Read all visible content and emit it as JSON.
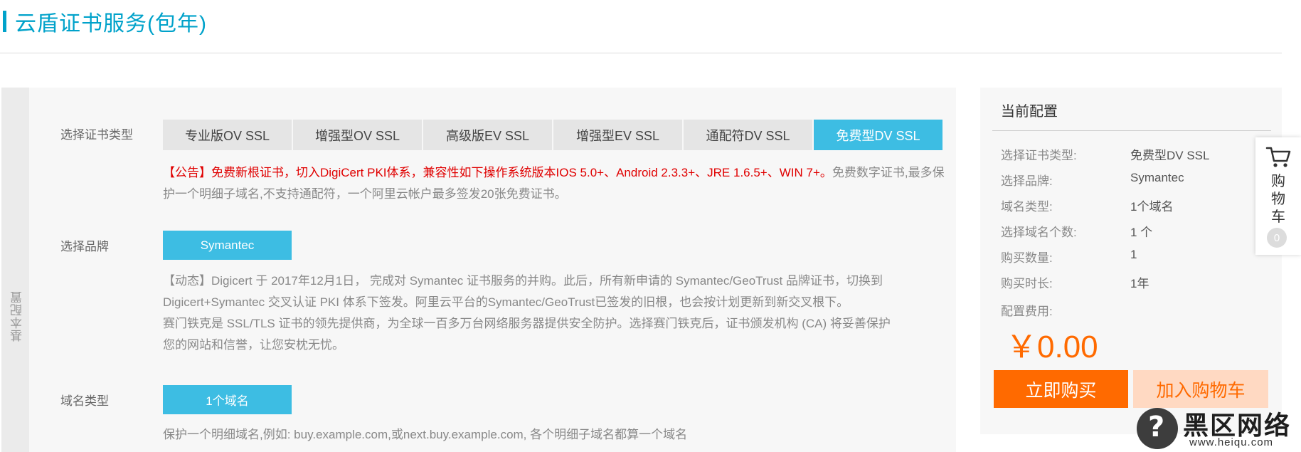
{
  "page": {
    "title": "云盾证书服务(包年)"
  },
  "main": {
    "side_tab_label": "基本配置",
    "cert_type": {
      "label": "选择证书类型",
      "tabs": [
        {
          "label": "专业版OV SSL",
          "active": false
        },
        {
          "label": "增强型OV SSL",
          "active": false
        },
        {
          "label": "高级版EV SSL",
          "active": false
        },
        {
          "label": "增强型EV SSL",
          "active": false
        },
        {
          "label": "通配符DV SSL",
          "active": false
        },
        {
          "label": "免费型DV SSL",
          "active": true
        }
      ],
      "notice_red": "【公告】免费新根证书，切入DigiCert PKI体系，兼容性如下操作系统版本IOS 5.0+、Android 2.3.3+、JRE 1.6.5+、WIN 7+。",
      "notice_gray": "免费数字证书,最多保护一个明细子域名,不支持通配符，一个阿里云帐户最多签发20张免费证书。"
    },
    "brand": {
      "label": "选择品牌",
      "button": "Symantec",
      "desc_line1": "【动态】Digicert 于 2017年12月1日， 完成对 Symantec 证书服务的并购。此后，所有新申请的 Symantec/GeoTrust 品牌证书，切换到",
      "desc_line2": "Digicert+Symantec 交叉认证 PKI 体系下签发。阿里云平台的Symantec/GeoTrust已签发的旧根，也会按计划更新到新交叉根下。",
      "desc_line3": "赛门铁克是 SSL/TLS 证书的领先提供商，为全球一百多万台网络服务器提供安全防护。选择赛门铁克后，证书颁发机构 (CA) 将妥善保护",
      "desc_line4": "您的网站和信誉，让您安枕无忧。"
    },
    "domain_type": {
      "label": "域名类型",
      "button": "1个域名",
      "desc": "保护一个明细域名,例如: buy.example.com,或next.buy.example.com, 各个明细子域名都算一个域名"
    }
  },
  "summary": {
    "title": "当前配置",
    "rows": [
      {
        "label": "选择证书类型:",
        "value": "免费型DV SSL"
      },
      {
        "label": "选择品牌:",
        "value": "Symantec"
      },
      {
        "label": "域名类型:",
        "value": "1个域名"
      },
      {
        "label": "选择域名个数:",
        "value": "1 个"
      },
      {
        "label": "购买数量:",
        "value": "1"
      },
      {
        "label": "购买时长:",
        "value": "1年"
      }
    ],
    "fee_label": "配置费用:",
    "price": "￥0.00",
    "buy_now": "立即购买",
    "add_to_cart": "加入购物车"
  },
  "cart_widget": {
    "icon": "shopping-cart-icon",
    "label": "购物车",
    "count": "0"
  },
  "watermark": {
    "text": "黑区网络",
    "url": "www.heiqu.com"
  },
  "colors": {
    "accent": "#00a2ca",
    "active_tab": "#3dbde3",
    "buy_orange": "#ff6a00",
    "notice_red": "#e00000"
  }
}
